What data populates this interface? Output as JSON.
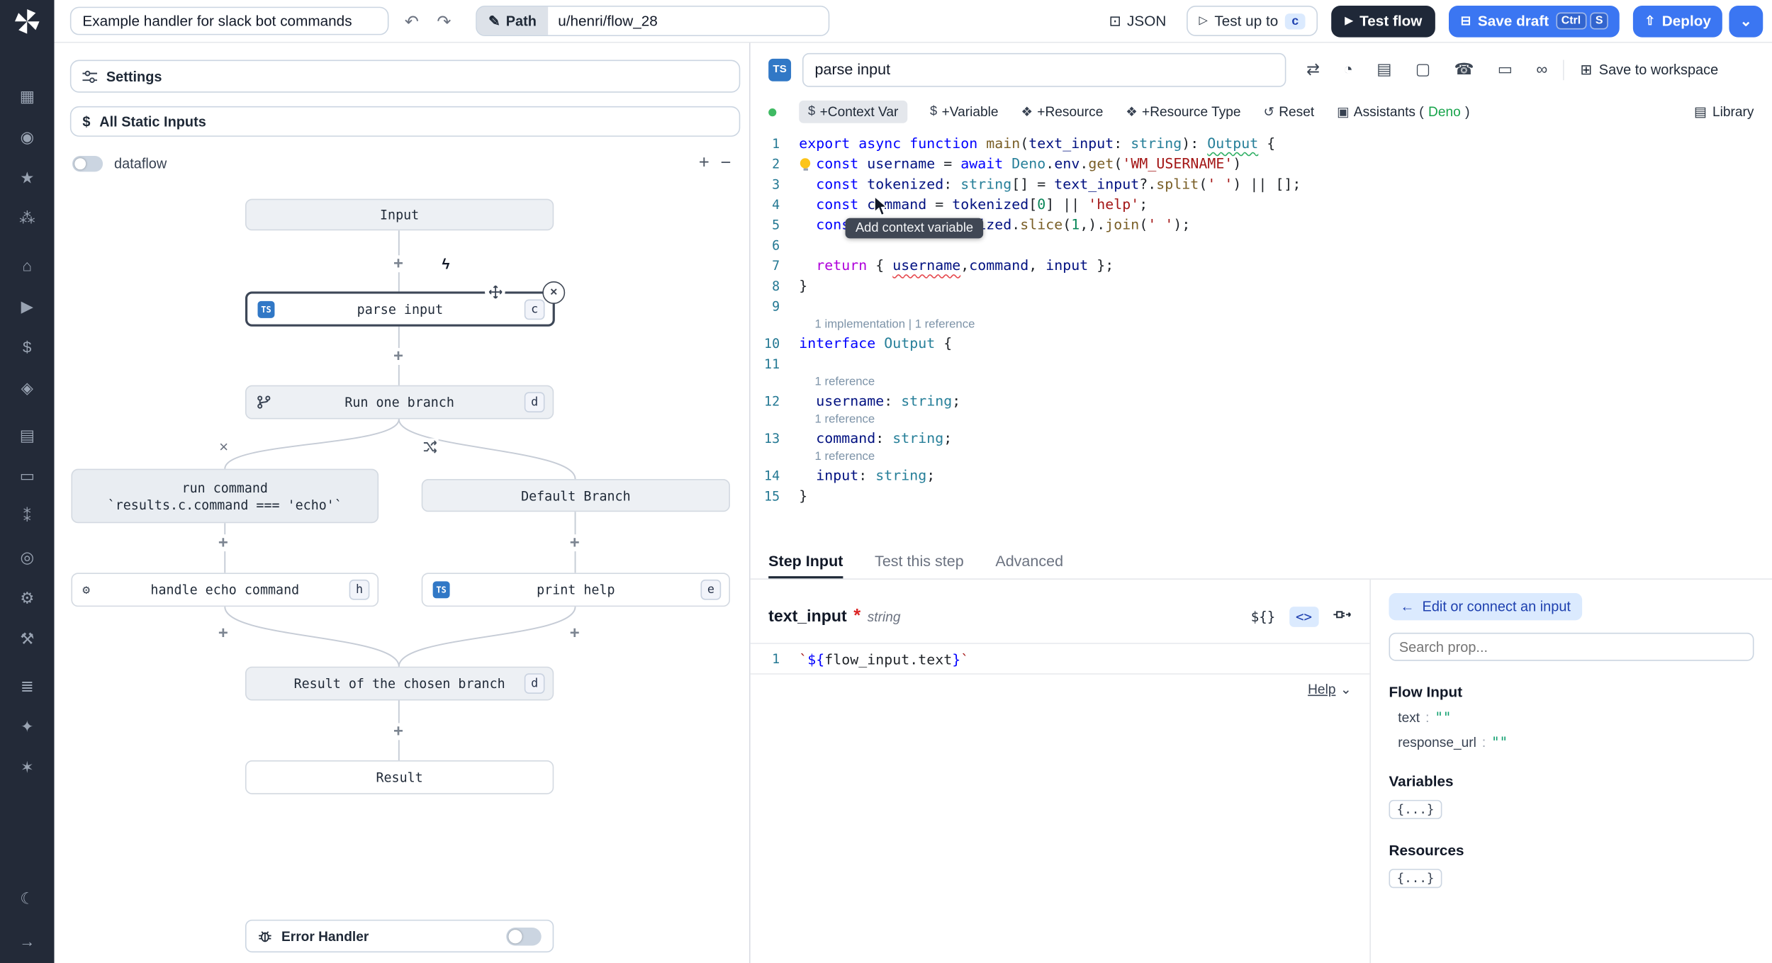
{
  "colors": {
    "accent_blue": "#3b76f2",
    "navy": "#1f2838",
    "ts_badge_blue": "#3178c6",
    "deno_green": "#16a34a",
    "badge_blue_bg": "#dbeafe",
    "status_green_dot": "#3fba63"
  },
  "sidebar": {
    "groups": [
      [
        {
          "g": "▦",
          "n": "apps-icon"
        },
        {
          "g": "◉",
          "n": "user-icon"
        },
        {
          "g": "★",
          "n": "favorites-icon"
        },
        {
          "g": "⁂",
          "n": "groups-icon"
        }
      ],
      [
        {
          "g": "⌂",
          "n": "home-icon"
        },
        {
          "g": "▶",
          "n": "runs-icon"
        },
        {
          "g": "$",
          "n": "variables-icon"
        },
        {
          "g": "◈",
          "n": "resources-icon"
        }
      ],
      [
        {
          "g": "▤",
          "n": "schedules-icon"
        },
        {
          "g": "▭",
          "n": "folders-icon"
        },
        {
          "g": "⁑",
          "n": "members-icon"
        },
        {
          "g": "◎",
          "n": "audit-icon"
        },
        {
          "g": "⚙",
          "n": "settings-icon"
        },
        {
          "g": "⚒",
          "n": "workers-icon"
        }
      ],
      [
        {
          "g": "≣",
          "n": "docs-icon"
        },
        {
          "g": "✦",
          "n": "discord-icon"
        },
        {
          "g": "✶",
          "n": "github-icon"
        }
      ]
    ],
    "bottom": [
      {
        "g": "☾",
        "n": "theme-toggle-icon"
      },
      {
        "g": "→",
        "n": "collapse-sidebar-icon"
      }
    ]
  },
  "topbar": {
    "title": "Example handler for slack bot commands",
    "path_label": "Path",
    "path_value": "u/henri/flow_28",
    "json_label": "JSON",
    "test_up_to_label": "Test up to",
    "test_up_to_badge": "c",
    "test_flow_label": "Test flow",
    "save_draft_label": "Save draft",
    "save_kbd": [
      "Ctrl",
      "S"
    ],
    "deploy_label": "Deploy"
  },
  "flow": {
    "settings_label": "Settings",
    "static_inputs_label": "All Static Inputs",
    "dataflow_label": "dataflow",
    "error_handler_label": "Error Handler",
    "zoom_in": "+",
    "zoom_out": "−",
    "nodes": {
      "input": {
        "label": "Input"
      },
      "parse_input": {
        "label": "parse input",
        "badge": "c",
        "lang": "TS"
      },
      "run_one_branch": {
        "label": "Run one branch",
        "badge": "d"
      },
      "run_command": {
        "label": "run command",
        "sublabel": "`results.c.command === 'echo'`"
      },
      "default_branch": {
        "label": "Default Branch"
      },
      "handle_echo": {
        "label": "handle echo command",
        "badge": "h",
        "icon": "⚙"
      },
      "print_help": {
        "label": "print help",
        "badge": "e",
        "lang": "TS"
      },
      "result_chosen": {
        "label": "Result of the chosen branch",
        "badge": "d"
      },
      "result": {
        "label": "Result"
      }
    }
  },
  "editor": {
    "step_name": "parse input",
    "lang_badge": "TS",
    "save_to_workspace": "Save to workspace",
    "library_label": "Library",
    "tooltip": "Add context variable",
    "head_icons": [
      {
        "g": "⇄",
        "n": "sync-icon"
      },
      {
        "g": "◔",
        "n": "gauge-icon"
      },
      {
        "g": "▤",
        "n": "library-icon"
      },
      {
        "g": "▢",
        "n": "window-icon"
      },
      {
        "g": "☎",
        "n": "phone-icon"
      },
      {
        "g": "▭",
        "n": "vehicle-icon"
      },
      {
        "g": "∞",
        "n": "voicemail-icon"
      }
    ],
    "toolbar": [
      {
        "icon": "$",
        "icon_name": "dollar-icon",
        "label": "+Context Var",
        "active": true
      },
      {
        "icon": "$",
        "icon_name": "dollar-icon",
        "label": "+Variable"
      },
      {
        "icon": "❖",
        "icon_name": "puzzle-icon",
        "label": "+Resource"
      },
      {
        "icon": "❖",
        "icon_name": "puzzle-icon",
        "label": "+Resource Type"
      },
      {
        "icon": "↺",
        "icon_name": "reset-icon",
        "label": "Reset"
      },
      {
        "icon": "▣",
        "icon_name": "assistants-icon",
        "label": "Assistants (",
        "accent": "Deno",
        "suffix": ")"
      }
    ],
    "rows": [
      {
        "n": 1,
        "t": [
          [
            "kw",
            "export"
          ],
          [
            "pl",
            " "
          ],
          [
            "kw",
            "async"
          ],
          [
            "pl",
            " "
          ],
          [
            "kw",
            "function"
          ],
          [
            "pl",
            " "
          ],
          [
            "fn",
            "main"
          ],
          [
            "pl",
            "("
          ],
          [
            "vr",
            "text_input"
          ],
          [
            "pl",
            ": "
          ],
          [
            "ty",
            "string"
          ],
          [
            "pl",
            "): "
          ],
          [
            "ty wg",
            "Output"
          ],
          [
            "pl",
            " {"
          ]
        ]
      },
      {
        "n": 2,
        "bulb": true,
        "t": [
          [
            "pl",
            "  "
          ],
          [
            "kw",
            "const"
          ],
          [
            "pl",
            " "
          ],
          [
            "vr",
            "username"
          ],
          [
            "pl",
            " = "
          ],
          [
            "kw",
            "await"
          ],
          [
            "pl",
            " "
          ],
          [
            "cls",
            "Deno"
          ],
          [
            "pl",
            "."
          ],
          [
            "vr",
            "env"
          ],
          [
            "pl",
            "."
          ],
          [
            "fn",
            "get"
          ],
          [
            "pl",
            "("
          ],
          [
            "str",
            "'WM_USERNAME'"
          ],
          [
            "pl",
            ")"
          ]
        ]
      },
      {
        "n": 3,
        "t": [
          [
            "pl",
            "  "
          ],
          [
            "kw",
            "const"
          ],
          [
            "pl",
            " "
          ],
          [
            "vr",
            "tokenized"
          ],
          [
            "pl",
            ": "
          ],
          [
            "ty",
            "string"
          ],
          [
            "pl",
            "[] = "
          ],
          [
            "vr",
            "text_input"
          ],
          [
            "pl",
            "?."
          ],
          [
            "fn",
            "split"
          ],
          [
            "pl",
            "("
          ],
          [
            "str",
            "' '"
          ],
          [
            "pl",
            ") || [];"
          ]
        ]
      },
      {
        "n": 4,
        "t": [
          [
            "pl",
            "  "
          ],
          [
            "kw",
            "const"
          ],
          [
            "pl",
            " "
          ],
          [
            "vr",
            "command"
          ],
          [
            "pl",
            " = "
          ],
          [
            "vr",
            "tokenized"
          ],
          [
            "pl",
            "["
          ],
          [
            "num",
            "0"
          ],
          [
            "pl",
            "] || "
          ],
          [
            "str",
            "'help'"
          ],
          [
            "pl",
            ";"
          ]
        ]
      },
      {
        "n": 5,
        "t": [
          [
            "pl",
            "  "
          ],
          [
            "kw",
            "const"
          ],
          [
            "pl",
            " "
          ],
          [
            "vr",
            "input"
          ],
          [
            "pl",
            " = "
          ],
          [
            "vr",
            "tokenized"
          ],
          [
            "pl",
            "."
          ],
          [
            "fn",
            "slice"
          ],
          [
            "pl",
            "("
          ],
          [
            "num",
            "1"
          ],
          [
            "pl",
            ",)."
          ],
          [
            "fn",
            "join"
          ],
          [
            "pl",
            "("
          ],
          [
            "str",
            "' '"
          ],
          [
            "pl",
            ");"
          ]
        ]
      },
      {
        "n": 6,
        "t": []
      },
      {
        "n": 7,
        "t": [
          [
            "pl",
            "  "
          ],
          [
            "ctl",
            "return"
          ],
          [
            "pl",
            " { "
          ],
          [
            "vr wr",
            "username"
          ],
          [
            "pl",
            ","
          ],
          [
            "vr",
            "command"
          ],
          [
            "pl",
            ", "
          ],
          [
            "vr",
            "input"
          ],
          [
            "pl",
            " };"
          ]
        ]
      },
      {
        "n": 8,
        "t": [
          [
            "pl",
            "}"
          ]
        ]
      },
      {
        "n": 9,
        "t": []
      },
      {
        "lens": "1 implementation | 1 reference"
      },
      {
        "n": 10,
        "t": [
          [
            "kw",
            "interface"
          ],
          [
            "pl",
            " "
          ],
          [
            "ty",
            "Output"
          ],
          [
            "pl",
            " {"
          ]
        ]
      },
      {
        "n": 11,
        "t": []
      },
      {
        "lens": "1 reference"
      },
      {
        "n": 12,
        "t": [
          [
            "pl",
            "  "
          ],
          [
            "vr",
            "username"
          ],
          [
            "pl",
            ": "
          ],
          [
            "ty",
            "string"
          ],
          [
            "pl",
            ";"
          ]
        ]
      },
      {
        "lens": "1 reference"
      },
      {
        "n": 13,
        "t": [
          [
            "pl",
            "  "
          ],
          [
            "vr",
            "command"
          ],
          [
            "pl",
            ": "
          ],
          [
            "ty",
            "string"
          ],
          [
            "pl",
            ";"
          ]
        ]
      },
      {
        "lens": "1 reference"
      },
      {
        "n": 14,
        "t": [
          [
            "pl",
            "  "
          ],
          [
            "vr",
            "input"
          ],
          [
            "pl",
            ": "
          ],
          [
            "ty",
            "string"
          ],
          [
            "pl",
            ";"
          ]
        ]
      },
      {
        "n": 15,
        "t": [
          [
            "pl",
            "}"
          ]
        ]
      }
    ]
  },
  "step_panel": {
    "tabs": [
      {
        "label": "Step Input",
        "active": true
      },
      {
        "label": "Test this step",
        "active": false
      },
      {
        "label": "Advanced",
        "active": false
      }
    ],
    "field_name": "text_input",
    "field_required": "*",
    "field_type": "string",
    "template_chip": "${}",
    "code_chip": "<>",
    "expr_line_number": "1",
    "expr_tokens": [
      [
        "str",
        "`"
      ],
      [
        "kw",
        "${"
      ],
      [
        "pl",
        "flow_input.text"
      ],
      [
        "kw",
        "}"
      ],
      [
        "str",
        "`"
      ]
    ],
    "help_label": "Help",
    "connect_button": "Edit or connect an input",
    "search_placeholder": "Search prop...",
    "flow_input_header": "Flow Input",
    "props": [
      {
        "key": "text",
        "value": "\"\""
      },
      {
        "key": "response_url",
        "value": "\"\""
      }
    ],
    "variables_header": "Variables",
    "resources_header": "Resources",
    "braces_badge": "{...}"
  }
}
